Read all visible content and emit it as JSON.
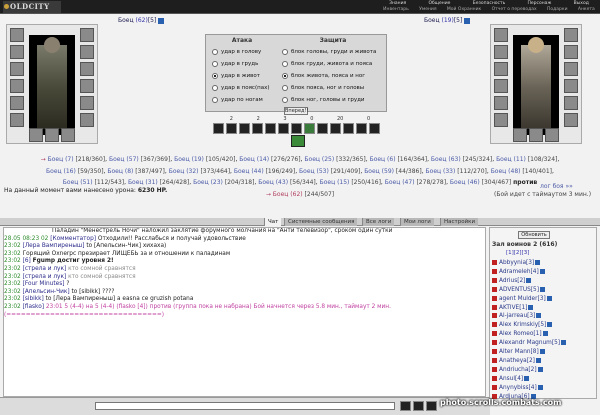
{
  "logo": "OLDCITY",
  "menu_top": [
    "Знания",
    "Общение",
    "Безопасность",
    "Персонаж",
    "Выход"
  ],
  "menu_bottom": [
    "Инвентарь",
    "Умения",
    "Мой Охранник",
    "Отчет о переводах",
    "Подарки",
    "Анкета"
  ],
  "left_fighter": {
    "name": "Боец",
    "level": "(62)",
    "rank": "[5]"
  },
  "right_fighter": {
    "name": "Боец",
    "level": "(19)",
    "rank": "[5]"
  },
  "panel": {
    "attack_title": "Атака",
    "defense_title": "Защита",
    "attacks": [
      "удар в голову",
      "удар в грудь",
      "удар в живот",
      "удар в пояс(пах)",
      "удар по ногам"
    ],
    "attack_selected": 2,
    "defenses": [
      "блок головы, груди и живота",
      "блок груди, живота и пояса",
      "блок живота, пояса и ног",
      "блок пояса, ног и головы",
      "блок ног, головы и груди"
    ],
    "defense_selected": 2,
    "go_button": "Вперед!!",
    "counters": [
      "2",
      "2",
      "3",
      "0",
      "20",
      "0"
    ]
  },
  "roster_line1": [
    {
      "n": "Боец",
      "l": "(7)",
      "hp": "[218/360]",
      "side": "a"
    },
    {
      "n": "Боец",
      "l": "(57)",
      "hp": "[367/369]",
      "side": "a"
    },
    {
      "n": "Боец",
      "l": "(19)",
      "hp": "[105/420]",
      "side": "a"
    },
    {
      "n": "Боец",
      "l": "(14)",
      "hp": "[276/276]",
      "side": "a"
    },
    {
      "n": "Боец",
      "l": "(25)",
      "hp": "[332/365]",
      "side": "a"
    },
    {
      "n": "Боец",
      "l": "(6)",
      "hp": "[164/364]",
      "side": "a"
    },
    {
      "n": "Боец",
      "l": "(63)",
      "hp": "[245/324]",
      "side": "a"
    },
    {
      "n": "Боец",
      "l": "(11)",
      "hp": "[108/324]",
      "side": "a"
    }
  ],
  "roster_line2": [
    {
      "n": "Боец",
      "l": "(16)",
      "hp": "[59/350]",
      "side": "a"
    },
    {
      "n": "Боец",
      "l": "(8)",
      "hp": "[387/497]",
      "side": "a"
    },
    {
      "n": "Боец",
      "l": "(32)",
      "hp": "[373/464]",
      "side": "a"
    },
    {
      "n": "Боец",
      "l": "(44)",
      "hp": "[196/249]",
      "side": "a"
    },
    {
      "n": "Боец",
      "l": "(53)",
      "hp": "[291/409]",
      "side": "a"
    },
    {
      "n": "Боец",
      "l": "(59)",
      "hp": "[44/386]",
      "side": "a"
    },
    {
      "n": "Боец",
      "l": "(33)",
      "hp": "[112/270]",
      "side": "a"
    },
    {
      "n": "Боец",
      "l": "(48)",
      "hp": "[140/401]",
      "side": "a"
    }
  ],
  "roster_line3": [
    {
      "n": "Боец",
      "l": "(51)",
      "hp": "[112/543]",
      "side": "a"
    },
    {
      "n": "Боец",
      "l": "(31)",
      "hp": "[264/428]",
      "side": "a"
    },
    {
      "n": "Боец",
      "l": "(23)",
      "hp": "[204/318]",
      "side": "a"
    },
    {
      "n": "Боец",
      "l": "(43)",
      "hp": "[56/344]",
      "side": "a"
    },
    {
      "n": "Боец",
      "l": "(15)",
      "hp": "[250/416]",
      "side": "a"
    },
    {
      "n": "Боец",
      "l": "(47)",
      "hp": "[278/278]",
      "side": "a"
    },
    {
      "n": "Боец",
      "l": "(46)",
      "hp": "[304/467]",
      "side": "a"
    }
  ],
  "vs_word": "против",
  "roster_opponent": {
    "n": "Боец",
    "l": "(62)",
    "hp": "[244/507]"
  },
  "damage": {
    "label": "На данный момент вами нанесено урона:",
    "value": "6230 HP."
  },
  "log_link": "лог боя »»",
  "wait_text": "(Бой идет с таймаутом 3 мин.)",
  "tabs": [
    "Чат",
    "Системные сообщения",
    "Все логи",
    "Мои логи",
    "Настройки"
  ],
  "chat": [
    {
      "t": "",
      "name": "",
      "text": "Паладин \"Менестрель Ночи\" наложил заклятие форумного молчания на \"Анти телевизор\", сроком один сутки",
      "cls": ""
    },
    {
      "t": "28.05 08:23 02",
      "name": "[Комментатор]",
      "text": "Отходили!! Расслабься и получай удовольствие",
      "cls": ""
    },
    {
      "t": "23:02",
      "name": "[Лера Вампиреныш]",
      "text": "to [Апельсин-Чик] хихаха)",
      "cls": ""
    },
    {
      "t": "23:02",
      "name": "",
      "text": "Горящий Oxnerpc презирает ЛИЩЕБЬ за и отношении к паладинам",
      "cls": ""
    },
    {
      "t": "23:02",
      "name": "[6]",
      "text": "Fgump достиг уровня 2!",
      "cls": ""
    },
    {
      "t": "23:02",
      "name": "[стрела и лук]",
      "text": "кто сомной сравнятся",
      "cls": "gray"
    },
    {
      "t": "23:02",
      "name": "[стрела и лук]",
      "text": "кто сомной сравнятся",
      "cls": "gray"
    },
    {
      "t": "23:02",
      "name": "[Four Minutes]",
      "text": "?",
      "cls": ""
    },
    {
      "t": "23:02",
      "name": "[Апельсин-Чик]",
      "text": "to [sibikk] ????",
      "cls": ""
    },
    {
      "t": "23:02",
      "name": "[sibikk]",
      "text": "to [Лера Вампиреныш] а еаsna се gruzish potana",
      "cls": ""
    },
    {
      "t": "23:02",
      "name": "[flasko]",
      "text": "23:01 5 (4-4) на 5 (4-4) (flasko [4]) против (группа пока не набрана) Бой начнется через 5.8 мин., таймаут 2 мин.",
      "cls": "pink"
    },
    {
      "t": "",
      "name": "",
      "text": "(================================)",
      "cls": "pink"
    }
  ],
  "users": {
    "refresh": "Обновить",
    "title": "Зал воинов 2 (616)",
    "pages": "[1][2][3]",
    "list": [
      "Abbyynia[3]",
      "Adrameleh[4]",
      "Adrius[2]",
      "ADVENTUS[5]",
      "agent Mulder[3]",
      "AKTIVE[1]",
      "Al-jarreau[3]",
      "Alex Krimskiy[5]",
      "Alex Romeo[1]",
      "Alexandr Magnum[5]",
      "Alter Mann[8]",
      "Anatheya[2]",
      "Andriucha[2]",
      "Ansul[4]",
      "Anynybiss[4]",
      "Ardjuna[6]"
    ]
  },
  "watermark": "photo.scrolls.combats.com"
}
